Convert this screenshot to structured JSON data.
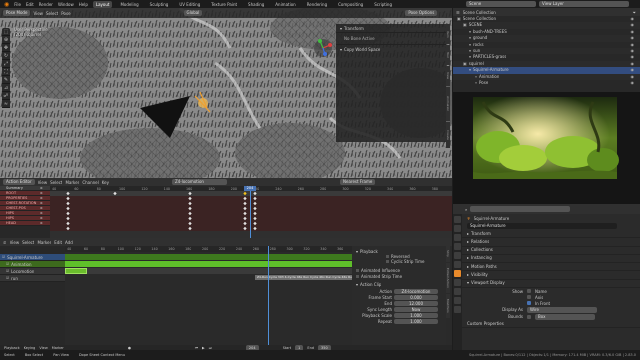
{
  "topbar": {
    "menu": [
      "File",
      "Edit",
      "Render",
      "Window",
      "Help"
    ],
    "workspaces": [
      "Layout",
      "Modeling",
      "Sculpting",
      "UV Editing",
      "Texture Paint",
      "Shading",
      "Animation",
      "Rendering",
      "Compositing",
      "Scripting"
    ],
    "active_workspace": "Layout",
    "scene": "Scene",
    "view_layer": "View Layer"
  },
  "viewport": {
    "mode": "Pose Mode",
    "menu": [
      "View",
      "Select",
      "Pose"
    ],
    "transform_orientation": "Global",
    "options_label": "Pose Options",
    "overlay_text": [
      "User Perspective",
      "(204) squirrel"
    ],
    "npanel": {
      "transform_header": "Transform",
      "no_bone": "No Bone Active",
      "copy_ws": "Copy World Space",
      "tabs": [
        "Item",
        "Tool",
        "View",
        "Animation",
        "Create"
      ]
    }
  },
  "outliner": {
    "header": "Scene Collection",
    "rows": [
      {
        "label": "Scene Collection",
        "depth": 0
      },
      {
        "label": "SCENE",
        "depth": 1
      },
      {
        "label": "bush-AND-TREES",
        "depth": 2
      },
      {
        "label": "ground",
        "depth": 2
      },
      {
        "label": "rocks",
        "depth": 2
      },
      {
        "label": "sun",
        "depth": 2
      },
      {
        "label": "PARTICLES-grass",
        "depth": 2
      },
      {
        "label": "squirrel",
        "depth": 1
      },
      {
        "label": "Squirrel-Armature",
        "depth": 2,
        "selected": true
      },
      {
        "label": "Animation",
        "depth": 3
      },
      {
        "label": "Pose",
        "depth": 3
      }
    ]
  },
  "action_editor": {
    "mode": "Action Editor",
    "menu": [
      "View",
      "Select",
      "Marker",
      "Channel",
      "Key"
    ],
    "action_name": "Z4-locomotion",
    "nearest": "Nearest Frame",
    "channels": [
      "Summary",
      "ROOT",
      "PROPERTIES",
      "CHEST-ROTATION",
      "CHEST-POS",
      "HIPS",
      "HIPS",
      "HEAD"
    ],
    "ruler": [
      "40",
      "60",
      "80",
      "100",
      "120",
      "140",
      "160",
      "180",
      "200",
      "220",
      "240",
      "260",
      "280",
      "300",
      "320",
      "340",
      "360",
      "380"
    ],
    "current_frame": "204"
  },
  "nla": {
    "menu": [
      "View",
      "Select",
      "Marker",
      "Edit",
      "Add"
    ],
    "tracks": [
      "Squirrel-Armature",
      "Animation",
      "Locomotion",
      "run"
    ],
    "ruler": [
      "40",
      "60",
      "80",
      "100",
      "120",
      "140",
      "160",
      "180",
      "200",
      "220",
      "240",
      "260",
      "280",
      "300",
      "320",
      "340",
      "360"
    ],
    "strip_label": "Z4-Run Cycle 303 4-Cycle 46x Run Cycle 46x Run Cycle 46x Run Cycle 46x Run Cycle 46x",
    "playback": {
      "title": "Playback",
      "reversed": "Reversed",
      "cyclic": "Cyclic Strip Time",
      "animated_influence": "Animated Influence",
      "animated_strip_time": "Animated Strip Time"
    },
    "action_clip": {
      "title": "Action Clip",
      "action_label": "Action",
      "action_value": "Z4-locomotion",
      "frame_start_label": "Frame Start",
      "frame_start": "0.000",
      "end_label": "End",
      "end": "12.000",
      "sync_label": "Sync Length",
      "now_btn": "Now",
      "scale_label": "Playback Scale",
      "scale": "1.000",
      "repeat_label": "Repeat",
      "repeat": "1.000"
    },
    "side_tabs": [
      "Strip",
      "Edited Action",
      "Modifiers"
    ]
  },
  "timeline": {
    "menu": [
      "Playback",
      "Keying",
      "View",
      "Marker"
    ],
    "frame": "204",
    "start_label": "Start",
    "start": "1",
    "end_label": "End",
    "end": "350"
  },
  "properties": {
    "object_name": "Squirrel-Armature",
    "data_name": "Squirrel-Armature",
    "sections": [
      "Transform",
      "Relations",
      "Collections",
      "Instancing",
      "Motion Paths",
      "Visibility",
      "Viewport Display",
      "Custom Properties"
    ],
    "viewport_display": {
      "show_label": "Show",
      "name": "Name",
      "axis": "Axis",
      "in_front": "In Front",
      "display_as_label": "Display As",
      "display_as": "Wire",
      "bounds_label": "Bounds",
      "bounds": "Box"
    }
  },
  "status": {
    "items": [
      "Select",
      "Box Select",
      "Pan View",
      "Dope Sheet Context Menu"
    ],
    "right": "Squirrel-Armature | Bones:0/112 | Objects:1/1 | Memory: 171.4 MiB | VRAM: 0.3/6.0 GiB | 2.83.0"
  },
  "colors": {
    "accent": "#4772b3",
    "playhead": "#4f8fd8",
    "red_channel": "#5c2a2a",
    "nla_green": "#5fbf2a",
    "nla_strip": "#6e6e6e"
  }
}
